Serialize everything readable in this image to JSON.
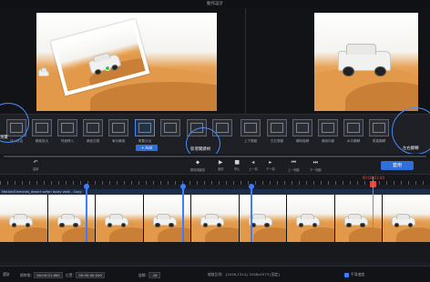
{
  "window": {
    "title": "動作設計"
  },
  "preview": {
    "left_label": "",
    "right_label": ""
  },
  "effects": [
    {
      "label": "淡入淡出"
    },
    {
      "label": "顯進放大"
    },
    {
      "label": "快速移入"
    },
    {
      "label": "畫面交錯"
    },
    {
      "label": "漸淡輪換"
    },
    {
      "label": "覆蓋淡出"
    },
    {
      "label": ""
    },
    {
      "label": ""
    },
    {
      "label": ""
    },
    {
      "label": "上下晃動"
    },
    {
      "label": "左右晃動"
    },
    {
      "label": "順時旋轉"
    },
    {
      "label": "畫面抖動"
    },
    {
      "label": "水平翻轉"
    },
    {
      "label": "垂直翻轉"
    }
  ],
  "effects_add_label": "+ Add",
  "highlights": {
    "left": "預覽",
    "center": "新增關鍵幀",
    "right": "左右翻轉"
  },
  "toolbar": {
    "undo": "還原",
    "reset": "刪除關鍵幀",
    "play": "播放",
    "stop": "停止",
    "prev": "上一幀",
    "next": "下一幀",
    "prev_key": "上一關鍵",
    "next_key": "下一關鍵",
    "apply": "套用"
  },
  "timeline": {
    "timecode": "00:00:03.00",
    "track_label": "Motion/Elements_desert safari dusty walk - Copy"
  },
  "status": {
    "selected": "選取",
    "duration_label": "總時間：",
    "duration_value": "00:00:01.600",
    "position_label": "位置：",
    "position_value": "00:00:00.000",
    "rotate_label": "旋轉：",
    "rotate_value": "-16",
    "size_label": "縮放比例：",
    "size_value": "{2026,1314}  2048x1573  [固定]",
    "checkbox_label": "平滑速度"
  }
}
